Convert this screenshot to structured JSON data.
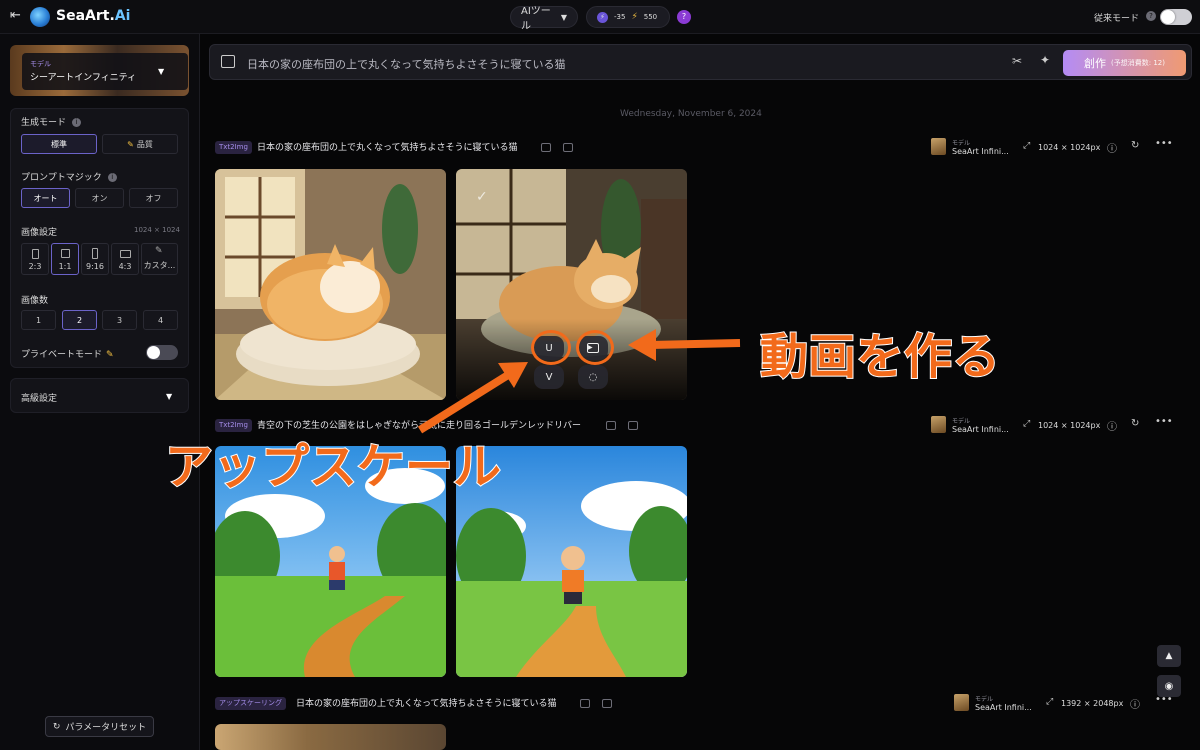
{
  "topbar": {
    "back_icon": "exit-left-icon",
    "brand_main": "SeaArt.",
    "brand_accent": "Ai",
    "tool_menu": "AIツール",
    "stamina_value": "-35",
    "energy_value": "550",
    "help_icon": "question-icon",
    "legacy_mode": "従来モード"
  },
  "sidebar": {
    "model_small_label": "モデル",
    "model_name": "シーアートインフィニティ",
    "generation_mode_label": "生成モード",
    "generation_modes": [
      "標準",
      "品質"
    ],
    "prompt_magic_label": "プロンプトマジック",
    "prompt_magic_options": [
      "オート",
      "オン",
      "オフ"
    ],
    "image_settings_label": "画像設定",
    "image_size": "1024 × 1024",
    "ratios": [
      "2:3",
      "1:1",
      "9:16",
      "4:3",
      "カスタ..."
    ],
    "image_count_label": "画像数",
    "image_counts": [
      "1",
      "2",
      "3",
      "4"
    ],
    "private_mode_label": "プライベートモード",
    "advanced_label": "高級設定",
    "reset_label": "パラメータリセット"
  },
  "prompt": {
    "text": "日本の家の座布団の上で丸くなって気持ちよさそうに寝ている猫",
    "create_label": "創作",
    "cost_label": "(予想消費数: 12)"
  },
  "date_label": "Wednesday, November 6, 2024",
  "rows": [
    {
      "tag": "Txt2Img",
      "prompt": "日本の家の座布団の上で丸くなって気持ちよさそうに寝ている猫",
      "model_small": "モデル",
      "model": "SeaArt Infini...",
      "resolution": "1024 × 1024px"
    },
    {
      "tag": "Txt2Img",
      "prompt": "青空の下の芝生の公園をはしゃぎながら元気に走り回るゴールデンレッドリバー",
      "model_small": "モデル",
      "model": "SeaArt Infini...",
      "resolution": "1024 × 1024px"
    },
    {
      "tag": "アップスケーリング",
      "prompt": "日本の家の座布団の上で丸くなって気持ちよさそうに寝ている猫",
      "model_small": "モデル",
      "model": "SeaArt Infini...",
      "resolution": "1392 × 2048px"
    }
  ],
  "overlay_buttons": {
    "upscale": "U",
    "variation": "V"
  },
  "annotations": {
    "video": "動画を作る",
    "upscale": "アップスケール"
  },
  "colors": {
    "accent": "#f26a1b",
    "brand_gradient_start": "#b48cf5",
    "brand_gradient_end": "#f09a72"
  }
}
